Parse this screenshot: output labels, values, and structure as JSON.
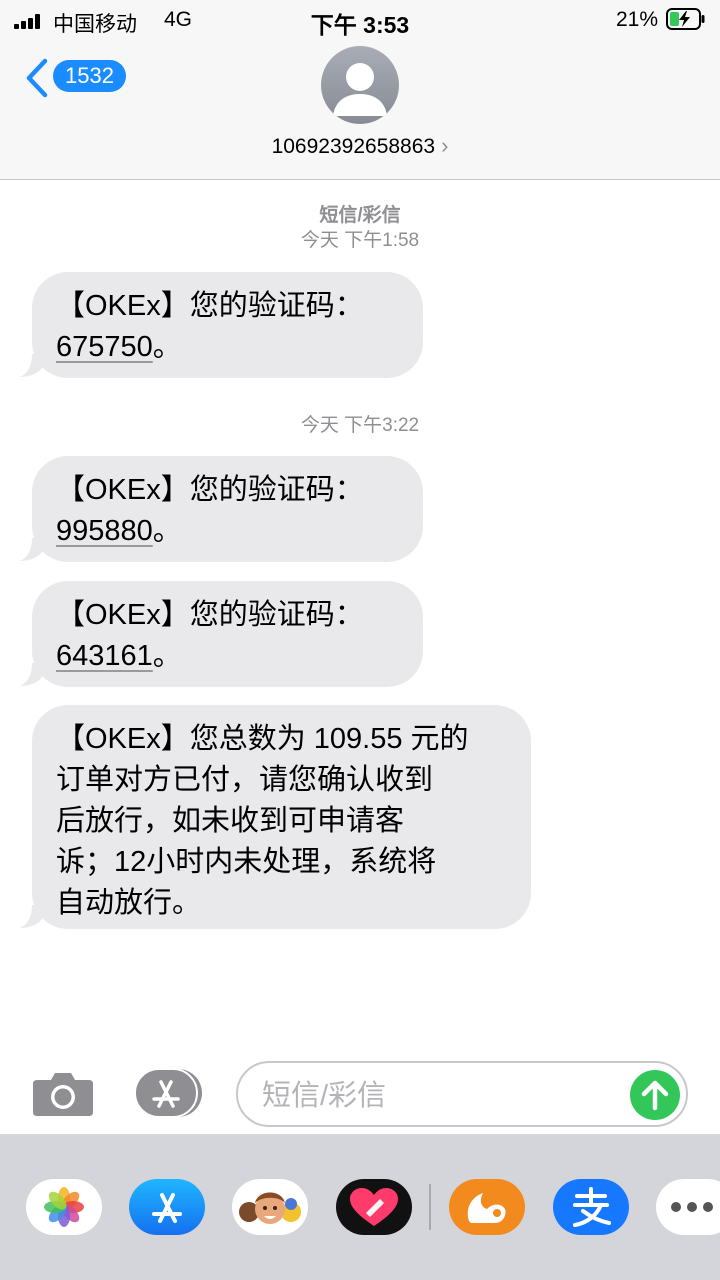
{
  "status_bar": {
    "carrier": "中国移动",
    "network": "4G",
    "time": "下午 3:53",
    "battery_percent": "21%"
  },
  "header": {
    "back_badge": "1532",
    "contact": "10692392658863",
    "icons": [
      "chevron-left-icon",
      "person-avatar-icon",
      "chevron-right-icon"
    ]
  },
  "messages": [
    {
      "meta_type": "短信/彩信",
      "meta_time": "今天 下午1:58",
      "text": "【OKEx】您的验证码：",
      "code": "675750",
      "suffix": "。"
    },
    {
      "meta_time": "今天 下午3:22",
      "text": "【OKEx】您的验证码：",
      "code": "995880",
      "suffix": "。"
    },
    {
      "text": "【OKEx】您的验证码：",
      "code": "643161",
      "suffix": "。"
    },
    {
      "lines": [
        "【OKEx】您总数为 109.55 元的",
        "订单对方已付，请您确认收到",
        "后放行，如未收到可申请客",
        "诉；12小时内未处理，系统将",
        "自动放行。"
      ]
    }
  ],
  "input_bar": {
    "placeholder": "短信/彩信",
    "icons": [
      "camera-icon",
      "app-store-icon",
      "arrow-up-icon"
    ]
  },
  "app_drawer": {
    "apps": [
      "photos",
      "app-store",
      "memoji",
      "digital-touch",
      "uc-browser",
      "alipay",
      "more"
    ]
  },
  "colors": {
    "accent_blue": "#1a8cff",
    "bubble_gray": "#e9e9eb",
    "send_green": "#33c759",
    "meta_gray": "#8e8e93",
    "drawer_bg": "#d4d5da"
  }
}
